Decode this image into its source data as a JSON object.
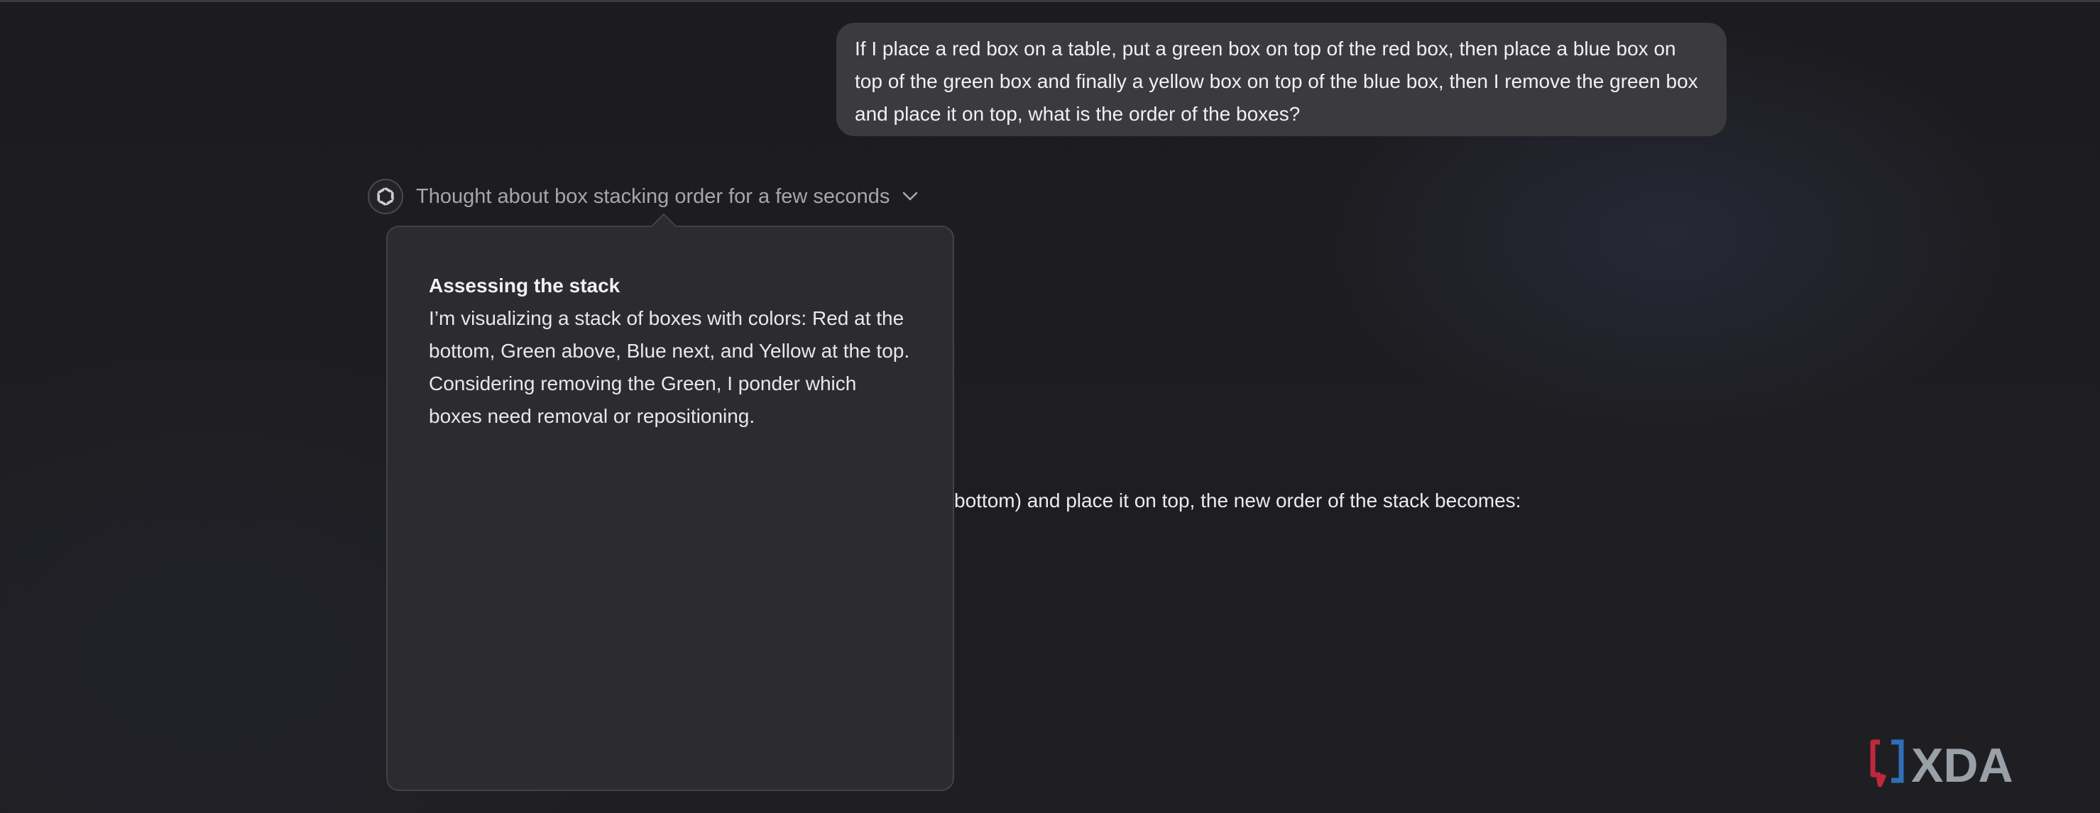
{
  "user_message": {
    "text": "If I place a red box on a table, put a green box on top of the red box, then place a blue box on top of the green box and finally a yellow box on top of the blue box, then I remove the green box and place it on top, what is the order of the boxes?"
  },
  "assistant": {
    "icon": "openai-logo-icon",
    "thought_label": "Thought about box stacking order for a few seconds",
    "thought_toggle_icon": "chevron-down-icon",
    "reasoning_popover": {
      "heading": "Assessing the stack",
      "body": "I’m visualizing a stack of boxes with colors: Red at the bottom, Green above, Blue next, and Yellow at the top. Considering removing the Green, I ponder which boxes need removal or repositioning."
    },
    "answer_partial": "bottom) and place it on top, the new order of the stack becomes:"
  },
  "watermark": {
    "text": "XDA",
    "colors": {
      "bracket_red": "#c0283c",
      "bracket_blue": "#2f6fb5",
      "letters": "#9aa0a8"
    }
  },
  "colors": {
    "background": "#1e1e21",
    "bubble": "#3a3a3f",
    "popover": "#2c2c30",
    "muted_text": "#a7a7ab"
  }
}
